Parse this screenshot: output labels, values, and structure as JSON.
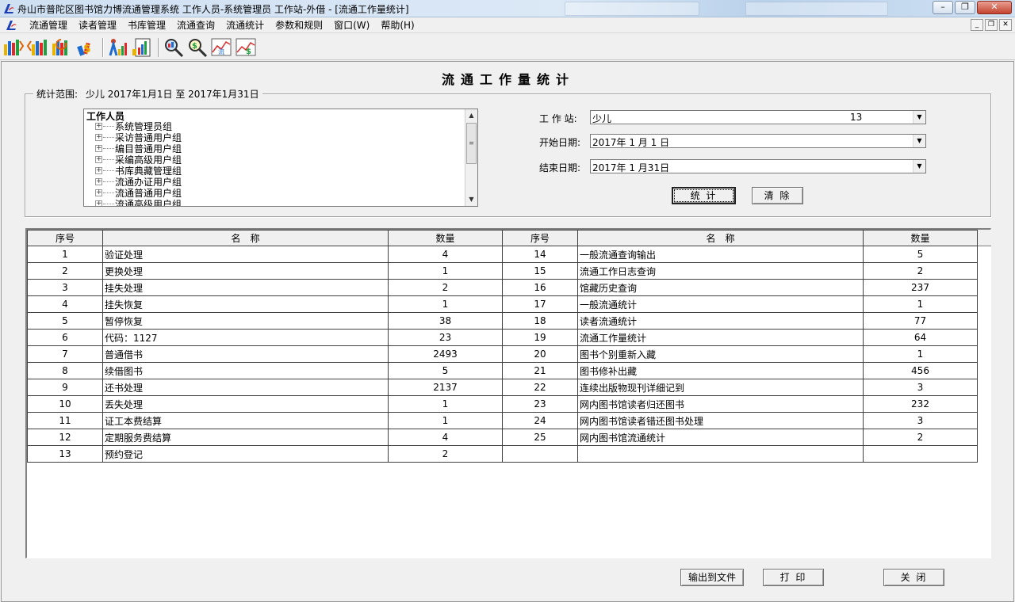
{
  "titlebar": {
    "title": "舟山市普陀区图书馆力博流通管理系统 工作人员-系统管理员 工作站-外借 - [流通工作量统计]",
    "minimize_glyph": "–",
    "restore_glyph": "❐",
    "close_glyph": "✕"
  },
  "menubar": {
    "items": [
      "流通管理",
      "读者管理",
      "书库管理",
      "流通查询",
      "流通统计",
      "参数和规则",
      "窗口(W)",
      "帮助(H)"
    ],
    "mdi_minimize": "_",
    "mdi_restore": "❐",
    "mdi_close": "✕"
  },
  "toolbar": {
    "icons": [
      "borrow-icon",
      "return-icon",
      "renew-icon",
      "fee-icon",
      "reader-stats-icon",
      "report-icon",
      "search-icon",
      "circulation-query-icon",
      "circulation-chart-icon",
      "fee-chart-icon"
    ]
  },
  "form": {
    "title": "流通工作量统计",
    "scope_label": "统计范围:",
    "scope_value": "少儿 2017年1月1日 至 2017年1月31日",
    "tree_root": "工作人员",
    "tree_items": [
      "系统管理员组",
      "采访普通用户组",
      "编目普通用户组",
      "采编高级用户组",
      "书库典藏管理组",
      "流通办证用户组",
      "流通普通用户组",
      "流通高级用户组"
    ],
    "station_label": "工 作 站:",
    "station_value": "少儿",
    "station_code": "13",
    "start_label": "开始日期:",
    "start_value": "2017年 1 月 1 日",
    "end_label": "结束日期:",
    "end_value": "2017年 1 月31日",
    "stat_button": "统 计",
    "clear_button": "清 除"
  },
  "grid": {
    "headers": [
      "序号",
      "名　称",
      "数量",
      "序号",
      "名　称",
      "数量"
    ],
    "rows": [
      [
        "1",
        "验证处理",
        "4",
        "14",
        "一般流通查询输出",
        "5"
      ],
      [
        "2",
        "更换处理",
        "1",
        "15",
        "流通工作日志查询",
        "2"
      ],
      [
        "3",
        "挂失处理",
        "2",
        "16",
        "馆藏历史查询",
        "237"
      ],
      [
        "4",
        "挂失恢复",
        "1",
        "17",
        "一般流通统计",
        "1"
      ],
      [
        "5",
        "暂停恢复",
        "38",
        "18",
        "读者流通统计",
        "77"
      ],
      [
        "6",
        "代码：1127",
        "23",
        "19",
        "流通工作量统计",
        "64"
      ],
      [
        "7",
        "普通借书",
        "2493",
        "20",
        "图书个别重新入藏",
        "1"
      ],
      [
        "8",
        "续借图书",
        "5",
        "21",
        "图书修补出藏",
        "456"
      ],
      [
        "9",
        "还书处理",
        "2137",
        "22",
        "连续出版物现刊详细记到",
        "3"
      ],
      [
        "10",
        "丢失处理",
        "1",
        "23",
        "网内图书馆读者归还图书",
        "232"
      ],
      [
        "11",
        "证工本费结算",
        "1",
        "24",
        "网内图书馆读者错还图书处理",
        "3"
      ],
      [
        "12",
        "定期服务费结算",
        "4",
        "25",
        "网内图书馆流通统计",
        "2"
      ],
      [
        "13",
        "预约登记",
        "2",
        "",
        "",
        ""
      ]
    ]
  },
  "footer": {
    "export_button": "输出到文件",
    "print_button": "打 印",
    "close_button": "关 闭"
  }
}
